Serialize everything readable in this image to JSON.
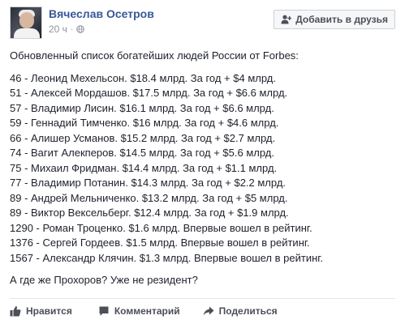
{
  "author": {
    "name": "Вячеслав Осетров",
    "time": "20 ч",
    "separator": "·"
  },
  "add_friend_label": "Добавить в друзья",
  "post": {
    "intro": "Обновленный список богатейших людей России от Forbes:",
    "lines": [
      "46 - Леонид Мехельсон. $18.4 млрд. За год + $4 млрд.",
      "51 - Алексей Мордашов. $17.5 млрд. За год + $6.6 млрд.",
      "57 - Владимир Лисин. $16.1 млрд. За год + $6.6 млрд.",
      "59 - Геннадий Тимченко. $16 млрд. За год + $4.6 млрд.",
      "66 - Алишер Усманов. $15.2 млрд. За год + $2.7 млрд.",
      "74 - Вагит Алекперов. $14.5 млрд. За год + $5.6 млрд.",
      "75 - Михаил Фридман. $14.4 млрд. За год + $1.1 млрд.",
      "77 - Владимир Потанин. $14.3 млрд. За год + $2.2 млрд.",
      "89 - Андрей Мельниченко. $13.2 млрд. За год + $5 млрд.",
      "89 - Виктор Вексельберг. $12.4 млрд. За год + $1.9 млрд.",
      "1290 - Роман Троценко. $1.6 млрд. Впервые вошел в рейтинг.",
      "1376 - Сергей Гордеев. $1.5 млрд. Впервые вошел в рейтинг.",
      "1567 - Александр Клячин. $1.3 млрд. Впервые вошел в рейтинг."
    ],
    "outro": "А где же Прохоров? Уже не резидент?"
  },
  "actions": {
    "like": "Нравится",
    "comment": "Комментарий",
    "share": "Поделиться"
  },
  "icons": {
    "avatar": "profile-photo",
    "globe": "globe-icon",
    "add_friend": "add-friend-icon",
    "like": "thumbs-up-icon",
    "comment": "comment-icon",
    "share": "share-arrow-icon"
  },
  "colors": {
    "author_link": "#365899",
    "muted": "#90949c",
    "text": "#1d2129",
    "button_bg": "#f6f7f9",
    "button_border": "#ced0d4",
    "action_text": "#4b4f56"
  }
}
